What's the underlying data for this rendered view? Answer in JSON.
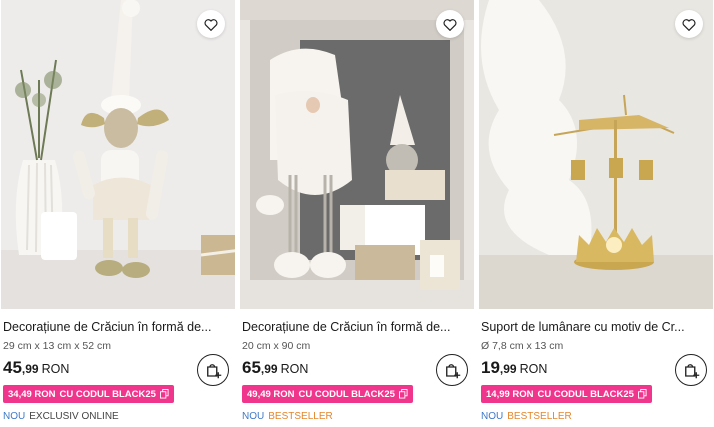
{
  "products": [
    {
      "title": "Decorațiune de Crăciun în formă de...",
      "dims": "29 cm x 13 cm x 52 cm",
      "price_main": "45",
      "price_decimals": ",99",
      "currency": "RON",
      "promo_price": "34,49 RON",
      "promo_code": "CU CODUL BLACK25",
      "tag_new": "NOU",
      "tag_secondary": "EXCLUSIV ONLINE",
      "image_icon": "christmas-reindeer-figurine"
    },
    {
      "title": "Decorațiune de Crăciun în formă de...",
      "dims": "20 cm x 90 cm",
      "price_main": "65",
      "price_decimals": ",99",
      "currency": "RON",
      "promo_price": "49,49 RON",
      "promo_code": "CU CODUL BLACK25",
      "tag_new": "NOU",
      "tag_secondary": "BESTSELLER",
      "image_icon": "christmas-gnome-figurine"
    },
    {
      "title": "Suport de lumânare cu motiv de Cr...",
      "dims": "Ø 7,8 cm x 13 cm",
      "price_main": "19",
      "price_decimals": ",99",
      "currency": "RON",
      "promo_price": "14,99 RON",
      "promo_code": "CU CODUL BLACK25",
      "tag_new": "NOU",
      "tag_secondary": "BESTSELLER",
      "image_icon": "candle-carousel-holder"
    }
  ],
  "colors": {
    "promo_bg": "#f0368c",
    "tag_new": "#3d79c7",
    "tag_bestseller": "#e3862c",
    "tag_exclusive": "#444444"
  }
}
